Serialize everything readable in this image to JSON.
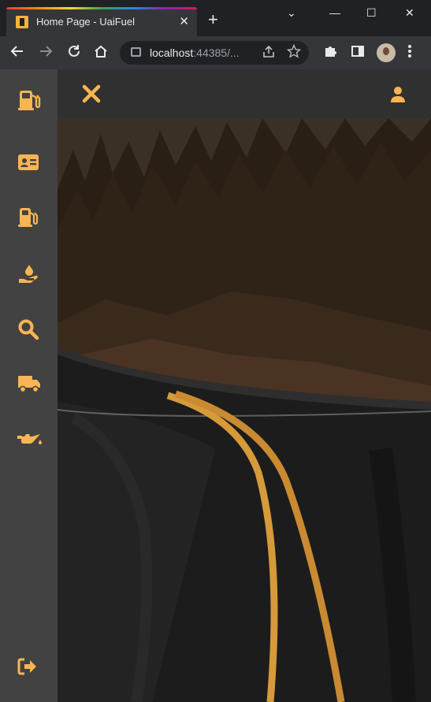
{
  "browser": {
    "tab_title": "Home Page - UaiFuel",
    "tab_close": "✕",
    "new_tab": "+",
    "url_host": "localhost",
    "url_rest": ":44385/...",
    "window_controls": {
      "minimize": "—",
      "maximize": "☐",
      "close": "✕",
      "dropdown": "⌄"
    }
  },
  "app": {
    "name": "UaiFuel",
    "accent_color": "#f9b553",
    "sidebar_items": [
      {
        "icon": "gas-station-icon"
      },
      {
        "icon": "id-card-icon"
      },
      {
        "icon": "gas-pump-icon"
      },
      {
        "icon": "hand-holding-water-icon"
      },
      {
        "icon": "search-icon"
      },
      {
        "icon": "truck-icon"
      },
      {
        "icon": "oil-can-icon"
      }
    ],
    "logout_icon": "sign-out-icon",
    "topbar": {
      "close_icon": "close-icon",
      "user_icon": "user-icon"
    }
  }
}
